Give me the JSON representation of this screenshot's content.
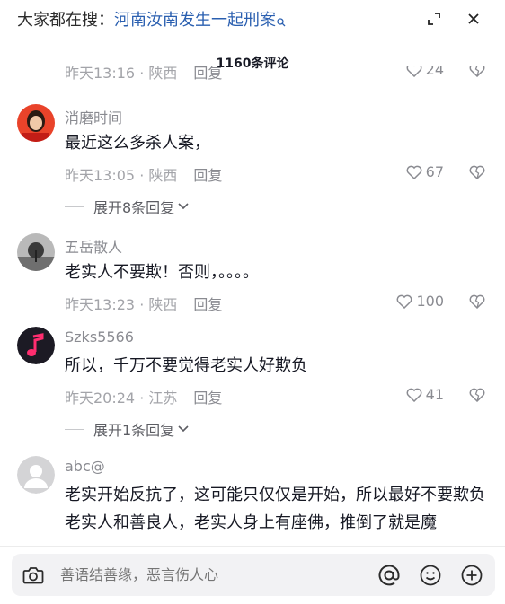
{
  "search": {
    "prefix": "大家都在搜：",
    "query": "河南汝南发生一起刑案",
    "search_icon": "magnifier-icon",
    "expand_icon": "expand-icon",
    "close_icon": "close-icon"
  },
  "comments_title": "1160条评论",
  "partial_prev": {
    "meta": "昨天13:16 · 陕西",
    "reply": "回复",
    "likes": "24"
  },
  "comments": [
    {
      "user": "消磨时间",
      "text": "最近这么多杀人案，",
      "meta": "昨天13:05 · 陕西",
      "reply": "回复",
      "likes": "67",
      "expand": "展开8条回复"
    },
    {
      "user": "五岳散人",
      "text": "老实人不要欺！否则，。。。。",
      "meta": "昨天13:23 · 陕西",
      "reply": "回复",
      "likes": "100"
    },
    {
      "user": "Szks5566",
      "text": "所以，千万不要觉得老实人好欺负",
      "meta": "昨天20:24 · 江苏",
      "reply": "回复",
      "likes": "41",
      "expand": "展开1条回复"
    },
    {
      "user": "abc@",
      "text": "老实开始反抗了，这可能只仅仅是开始，所以最好不要欺负老实人和善良人，老实人身上有座佛，推倒了就是魔"
    }
  ],
  "input": {
    "placeholder": "善语结善缘，恶言伤人心"
  },
  "colors": {
    "link": "#2a5fb0",
    "muted": "#8a8b91",
    "text": "#161823"
  }
}
